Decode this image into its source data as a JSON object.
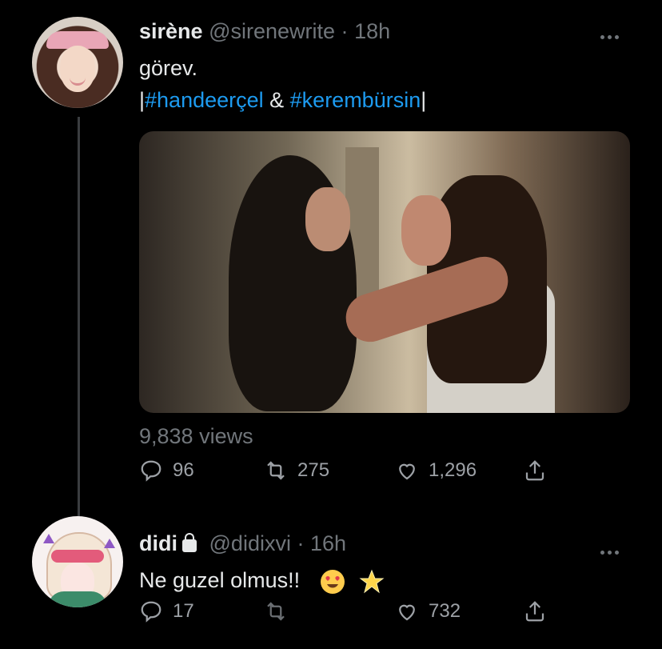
{
  "tweets": [
    {
      "name": "sirène",
      "handle": "@sirenewrite",
      "separator": "·",
      "time": "18h",
      "text_line1": "görev.",
      "text_line2_prefix": "|",
      "hashtag1": "#handeerçel",
      "text_between": " & ",
      "hashtag2": "#kerembürsin",
      "text_line2_suffix": "|",
      "views": "9,838 views",
      "replies": "96",
      "retweets": "275",
      "likes": "1,296"
    },
    {
      "name": "didi",
      "handle": "@didixvi",
      "separator": "·",
      "time": "16h",
      "text": "Ne guzel olmus!!",
      "replies": "17",
      "retweets": "",
      "likes": "732"
    }
  ],
  "colors": {
    "background": "#000000",
    "text": "#e7e9ea",
    "meta": "#71767b",
    "hashtag": "#1d9bf0",
    "thread_line": "#3a3d40"
  },
  "icons": [
    "reply-icon",
    "retweet-icon",
    "like-icon",
    "share-icon",
    "lock-icon",
    "more-icon"
  ]
}
